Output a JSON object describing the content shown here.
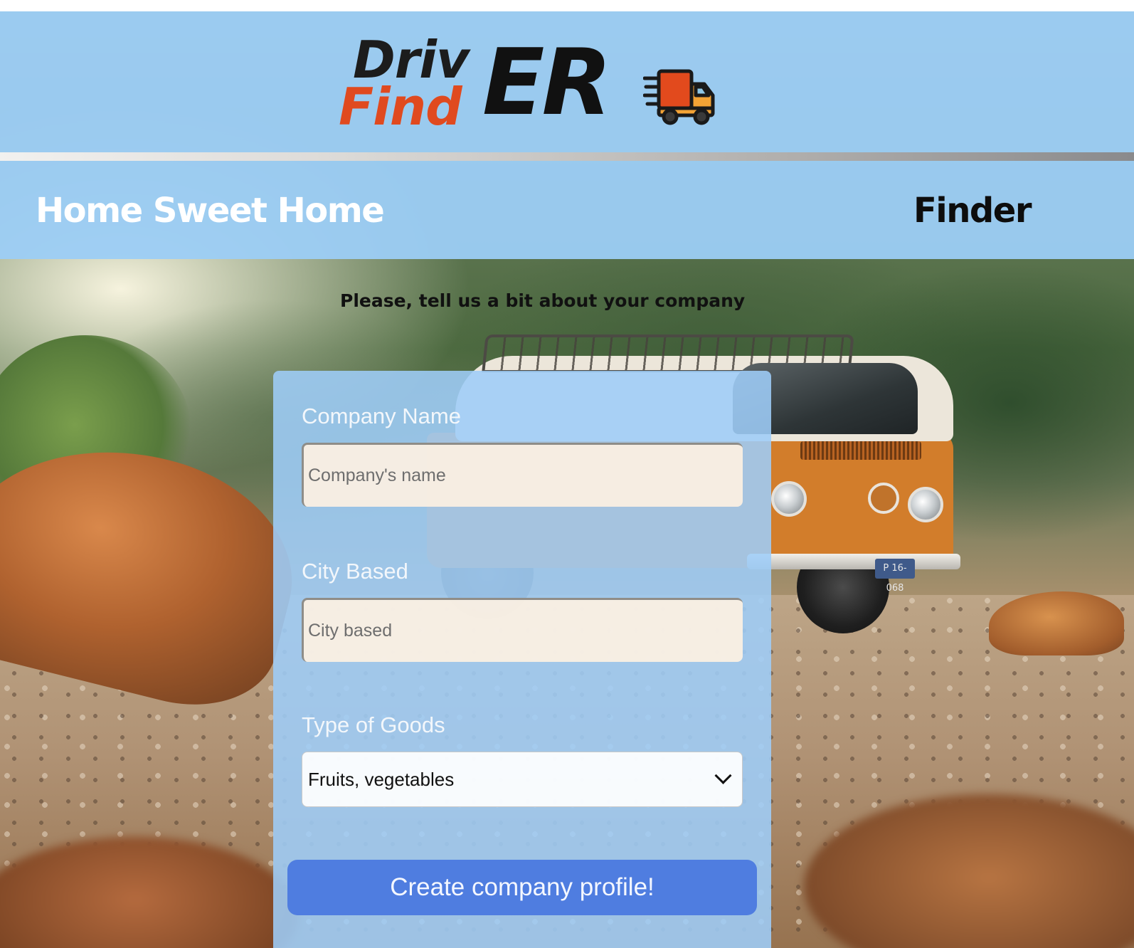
{
  "brand": {
    "logo_top": "Driv",
    "logo_bottom": "Find",
    "logo_suffix": "ER",
    "logo_icon": "truck-icon",
    "colors": {
      "dark": "#111111",
      "accent": "#e04a1f",
      "truck_orange": "#f39a2e"
    }
  },
  "nav": {
    "home_label": "Home Sweet Home",
    "finder_label": "Finder"
  },
  "form": {
    "prompt": "Please, tell us a bit about your company",
    "company_name": {
      "label": "Company Name",
      "placeholder": "Company's name",
      "value": ""
    },
    "city": {
      "label": "City Based",
      "placeholder": "City based",
      "value": ""
    },
    "goods": {
      "label": "Type of Goods",
      "selected": "Fruits, vegetables"
    },
    "submit_label": "Create company profile!",
    "colors": {
      "panel": "#9ecdf8",
      "button": "#4f7de0"
    }
  },
  "van": {
    "plate": "P 16-068"
  }
}
